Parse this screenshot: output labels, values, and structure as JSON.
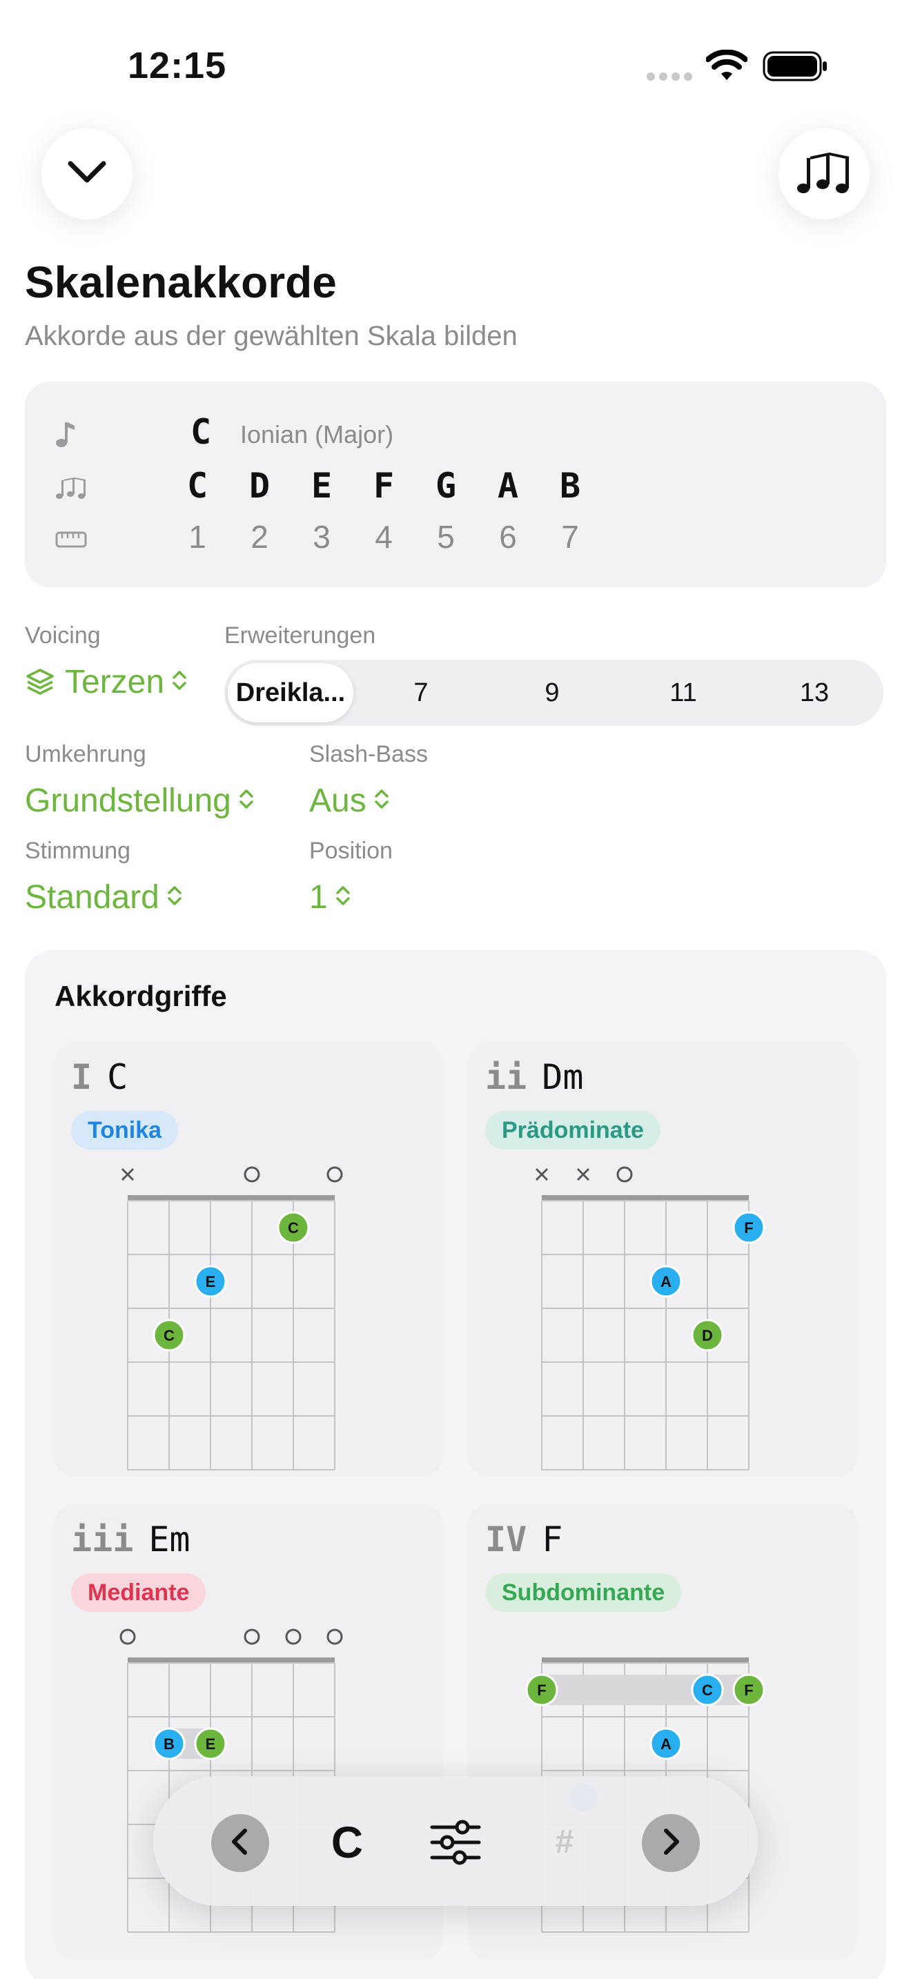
{
  "status": {
    "time": "12:15"
  },
  "header": {
    "title": "Skalenakkorde",
    "subtitle": "Akkorde aus der gewählten Skala bilden"
  },
  "scale": {
    "root": "C",
    "mode": "Ionian (Major)",
    "notes": [
      "C",
      "D",
      "E",
      "F",
      "G",
      "A",
      "B"
    ],
    "degrees": [
      "1",
      "2",
      "3",
      "4",
      "5",
      "6",
      "7"
    ]
  },
  "settings": {
    "voicing_label": "Voicing",
    "voicing_value": "Terzen",
    "extensions_label": "Erweiterungen",
    "extensions": [
      "Dreikla...",
      "7",
      "9",
      "11",
      "13"
    ],
    "extension_selected": "Dreikla...",
    "inversion_label": "Umkehrung",
    "inversion_value": "Grundstellung",
    "slash_label": "Slash-Bass",
    "slash_value": "Aus",
    "tuning_label": "Stimmung",
    "tuning_value": "Standard",
    "position_label": "Position",
    "position_value": "1"
  },
  "chords_section": {
    "title": "Akkordgriffe",
    "chords": [
      {
        "roman": "I",
        "name": "C",
        "function": "Tonika",
        "badge_bg": "#d6e8fa",
        "badge_fg": "#1f86e0",
        "markers": [
          "x",
          "",
          "",
          "o",
          "",
          "o"
        ],
        "barre": null,
        "dots": [
          {
            "string": 5,
            "fret": 1,
            "note": "C",
            "color": "green"
          },
          {
            "string": 3,
            "fret": 2,
            "note": "E",
            "color": "blue"
          },
          {
            "string": 2,
            "fret": 3,
            "note": "C",
            "color": "green"
          }
        ]
      },
      {
        "roman": "ii",
        "name": "Dm",
        "function": "Prädominate",
        "badge_bg": "#d6ede8",
        "badge_fg": "#2a9a85",
        "markers": [
          "x",
          "x",
          "o",
          "",
          "",
          ""
        ],
        "barre": null,
        "dots": [
          {
            "string": 6,
            "fret": 1,
            "note": "F",
            "color": "blue"
          },
          {
            "string": 4,
            "fret": 2,
            "note": "A",
            "color": "blue"
          },
          {
            "string": 5,
            "fret": 3,
            "note": "D",
            "color": "green"
          }
        ]
      },
      {
        "roman": "iii",
        "name": "Em",
        "function": "Mediante",
        "badge_bg": "#fad6dc",
        "badge_fg": "#e0334f",
        "markers": [
          "o",
          "",
          "",
          "o",
          "o",
          "o"
        ],
        "barre": {
          "from": 2,
          "to": 3,
          "fret": 2
        },
        "dots": [
          {
            "string": 2,
            "fret": 2,
            "note": "B",
            "color": "blue"
          },
          {
            "string": 3,
            "fret": 2,
            "note": "E",
            "color": "green"
          }
        ]
      },
      {
        "roman": "IV",
        "name": "F",
        "function": "Subdominante",
        "badge_bg": "#d9eedd",
        "badge_fg": "#34a853",
        "markers": [
          "",
          "",
          "",
          "",
          "",
          ""
        ],
        "barre": {
          "from": 1,
          "to": 6,
          "fret": 1
        },
        "dots": [
          {
            "string": 1,
            "fret": 1,
            "note": "F",
            "color": "green"
          },
          {
            "string": 5,
            "fret": 1,
            "note": "C",
            "color": "blue"
          },
          {
            "string": 6,
            "fret": 1,
            "note": "F",
            "color": "green"
          },
          {
            "string": 4,
            "fret": 2,
            "note": "A",
            "color": "blue"
          },
          {
            "string": 2,
            "fret": 3,
            "note": "",
            "color": "blue"
          }
        ]
      }
    ]
  },
  "toolbar": {
    "key_label": "C",
    "sharp_label": "#"
  },
  "colors": {
    "accent_green": "#6cb63d",
    "dot_green": "#6cb63d",
    "dot_blue": "#29aff0"
  }
}
